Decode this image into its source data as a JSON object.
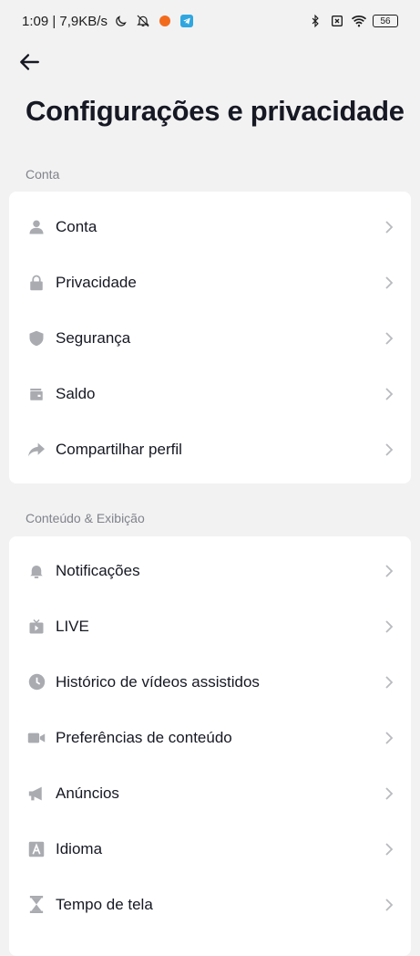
{
  "status_bar": {
    "time_speed": "1:09 | 7,9KB/s",
    "battery": "56"
  },
  "page": {
    "title": "Configurações e privacidade"
  },
  "sections": [
    {
      "header": "Conta",
      "items": [
        {
          "label": "Conta",
          "icon": "person-icon"
        },
        {
          "label": "Privacidade",
          "icon": "lock-icon"
        },
        {
          "label": "Segurança",
          "icon": "shield-icon"
        },
        {
          "label": "Saldo",
          "icon": "wallet-icon"
        },
        {
          "label": "Compartilhar perfil",
          "icon": "share-icon"
        }
      ]
    },
    {
      "header": "Conteúdo & Exibição",
      "items": [
        {
          "label": "Notificações",
          "icon": "bell-icon"
        },
        {
          "label": "LIVE",
          "icon": "live-tv-icon"
        },
        {
          "label": "Histórico de vídeos assistidos",
          "icon": "clock-icon"
        },
        {
          "label": "Preferências de conteúdo",
          "icon": "video-camera-icon"
        },
        {
          "label": "Anúncios",
          "icon": "megaphone-icon"
        },
        {
          "label": "Idioma",
          "icon": "language-icon"
        },
        {
          "label": "Tempo de tela",
          "icon": "hourglass-icon"
        }
      ]
    }
  ],
  "colors": {
    "background": "#f2f2f3",
    "card": "#ffffff",
    "icon": "#a9abb0",
    "chevron": "#b8babe",
    "text": "#161823",
    "section_header": "#80838a"
  }
}
